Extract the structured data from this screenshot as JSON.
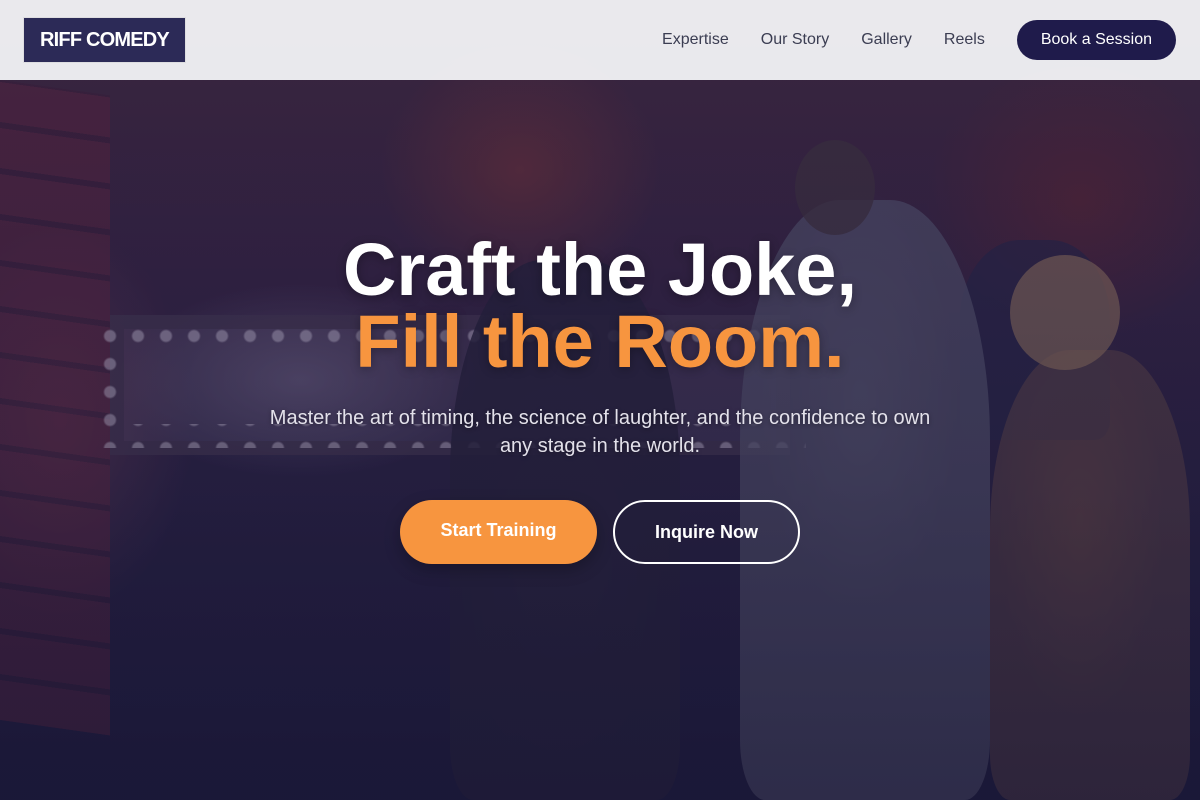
{
  "header": {
    "logo": "RIFF COMEDY",
    "nav": [
      "Expertise",
      "Our Story",
      "Gallery",
      "Reels"
    ],
    "cta_label": "Book a Session"
  },
  "hero": {
    "headline_line1": "Craft the Joke,",
    "headline_line2": "Fill the Room.",
    "subtitle": "Master the art of timing, the science of laughter, and the confidence to own any stage in the world.",
    "primary_button": "Start Training",
    "secondary_button": "Inquire Now"
  },
  "colors": {
    "brand_navy": "#1f1b4b",
    "logo_bg": "#2c2a57",
    "accent_orange": "#f7953f",
    "nav_text": "#3b3d52",
    "header_bg": "#f0f0f3"
  },
  "background_image": "comedy-club-photo"
}
